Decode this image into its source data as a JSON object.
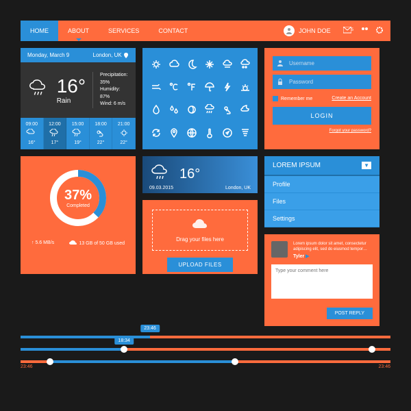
{
  "nav": {
    "items": [
      "HOME",
      "ABOUT",
      "SERVICES",
      "CONTACT"
    ],
    "user": "JOHN DOE",
    "badge": "5"
  },
  "weather": {
    "date": "Monday, March 9",
    "location": "London, UK",
    "temp": "16°",
    "condition": "Rain",
    "precipitation": "Precipitation: 35%",
    "humidity": "Humidity: 87%",
    "wind": "Wind: 6 m/s",
    "hours": [
      {
        "t": "09:00",
        "d": "16°"
      },
      {
        "t": "12:00",
        "d": "17°"
      },
      {
        "t": "15:00",
        "d": "19°"
      },
      {
        "t": "18:00",
        "d": "22°"
      },
      {
        "t": "21:00",
        "d": "22°"
      }
    ]
  },
  "mini": {
    "temp": "16°",
    "date": "09.03.2015",
    "loc": "London, UK"
  },
  "login": {
    "user_ph": "Username",
    "pass_ph": "Password",
    "remember": "Remember me",
    "create": "Create an Account",
    "btn": "LOGIN",
    "forgot": "Forgot your password?"
  },
  "dropdown": {
    "title": "LOREM IPSUM",
    "items": [
      "Profile",
      "Files",
      "Settings"
    ]
  },
  "progress": {
    "pct": "37%",
    "lbl": "Completed",
    "speed": "5.6 MB/s",
    "used": "13 GB of 50 GB used"
  },
  "upload": {
    "drag": "Drag your files here",
    "btn": "UPLOAD FILES"
  },
  "comment": {
    "text": "Lorem ipsum dolor sit amet, consectetur adipiscing elit, sed do eiusmod tempor…",
    "name": "Tyler",
    "ph": "Type your comment here",
    "btn": "POST REPLY"
  },
  "sliders": {
    "s1": "23:46",
    "s2": "18:34",
    "s3l": "23:46",
    "s3r": "23:46"
  }
}
